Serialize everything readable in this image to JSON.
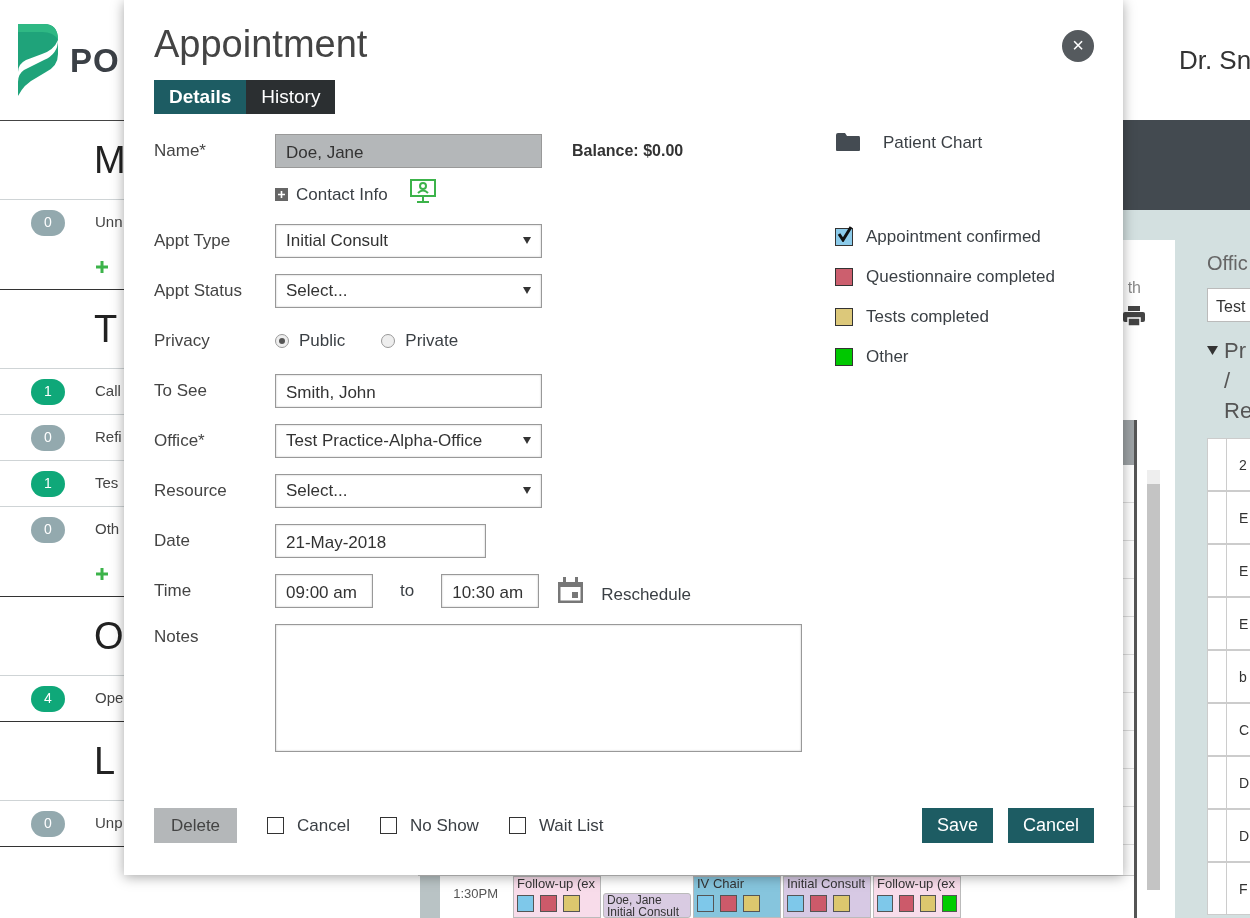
{
  "logo": {
    "text": "PO"
  },
  "user": {
    "name": "Dr. Sn"
  },
  "sidebar": [
    {
      "title": "M",
      "add": true,
      "items": [
        {
          "count": "0",
          "label": "Unn",
          "highlighted": false
        }
      ]
    },
    {
      "title": "T",
      "add": true,
      "items": [
        {
          "count": "1",
          "label": "Call",
          "highlighted": true
        },
        {
          "count": "0",
          "label": "Refi",
          "highlighted": false
        },
        {
          "count": "1",
          "label": "Tes",
          "highlighted": true
        },
        {
          "count": "0",
          "label": "Oth",
          "highlighted": false
        }
      ]
    },
    {
      "title": "O",
      "add": false,
      "items": [
        {
          "count": "4",
          "label": "Ope",
          "highlighted": true
        }
      ]
    },
    {
      "title": "L",
      "add": false,
      "items": [
        {
          "count": "0",
          "label": "Unp",
          "highlighted": false
        }
      ]
    }
  ],
  "schedule": {
    "view_label": "th",
    "time": "1:30PM",
    "appointments": [
      {
        "kind": "block",
        "title": "Follow-up (ex",
        "color": "#f8dcea",
        "markers": [
          {
            "color": "#7ec8ea"
          },
          {
            "color": "#cc5a6a"
          },
          {
            "color": "#dcc76e"
          }
        ]
      },
      {
        "kind": "nested",
        "title": "Doe, Jane",
        "subtitle": "Initial Consult",
        "color": "#d9cbe2"
      },
      {
        "kind": "block",
        "title": "IV Chair",
        "color": "#86c5dd",
        "markers": [
          {
            "color": "#7ec8ea"
          },
          {
            "color": "#cc5a6a"
          },
          {
            "color": "#dcc76e"
          }
        ]
      },
      {
        "kind": "block",
        "title": "Initial Consult",
        "color": "#d7c9e4",
        "markers": [
          {
            "color": "#7ec8ea"
          },
          {
            "color": "#cc5a6a"
          },
          {
            "color": "#dcc76e"
          }
        ]
      },
      {
        "kind": "block",
        "title": "Follow-up (ex",
        "color": "#f8dcea",
        "markers": [
          {
            "color": "#7ec8ea"
          },
          {
            "color": "#cc5a6a"
          },
          {
            "color": "#dcc76e"
          },
          {
            "color": "#00cc00"
          }
        ]
      }
    ]
  },
  "filter_panel": {
    "heading": "Offic",
    "office_select": "Test",
    "group": {
      "expanded": true,
      "lines": [
        "Pr",
        "/ Re"
      ]
    },
    "rows": [
      "2",
      "E",
      "E",
      "E",
      "b",
      "C",
      "D",
      "D",
      "F"
    ]
  },
  "modal": {
    "title": "Appointment",
    "close": "×",
    "tabs": [
      {
        "label": "Details",
        "selected": true
      },
      {
        "label": "History",
        "selected": false
      }
    ],
    "balance": "Balance: $0.00",
    "contact_info": "Contact Info",
    "fields": [
      {
        "kind": "input",
        "label": "Name*",
        "value": "Doe, Jane",
        "disabled": true
      },
      {
        "kind": "contact"
      },
      {
        "kind": "select",
        "label": "Appt Type",
        "value": "Initial Consult"
      },
      {
        "kind": "select",
        "label": "Appt Status",
        "value": "Select..."
      },
      {
        "kind": "radio",
        "label": "Privacy",
        "options": [
          {
            "label": "Public",
            "selected": true
          },
          {
            "label": "Private",
            "selected": false
          }
        ]
      },
      {
        "kind": "input",
        "label": "To See",
        "value": "Smith, John",
        "disabled": false
      },
      {
        "kind": "select",
        "label": "Office*",
        "value": "Test Practice-Alpha-Office"
      },
      {
        "kind": "select",
        "label": "Resource",
        "value": "Select..."
      },
      {
        "kind": "date",
        "label": "Date",
        "value": "21-May-2018"
      },
      {
        "kind": "time",
        "label": "Time",
        "start": "09:00 am",
        "joiner": "to",
        "end": "10:30 am",
        "action": "Reschedule"
      },
      {
        "kind": "textarea",
        "label": "Notes"
      }
    ],
    "patient_chart": "Patient Chart",
    "legend": [
      {
        "label": "Appointment confirmed",
        "color": "#8ccbea",
        "checked": true
      },
      {
        "label": "Questionnaire completed",
        "color": "#cc5f6e",
        "checked": false
      },
      {
        "label": "Tests completed",
        "color": "#dcc87a",
        "checked": false
      },
      {
        "label": "Other",
        "color": "#00c800",
        "checked": false
      }
    ],
    "delete": "Delete",
    "flags": [
      {
        "label": "Cancel",
        "checked": false
      },
      {
        "label": "No Show",
        "checked": false
      },
      {
        "label": "Wait List",
        "checked": false
      }
    ],
    "actions": [
      "Save",
      "Cancel"
    ]
  }
}
